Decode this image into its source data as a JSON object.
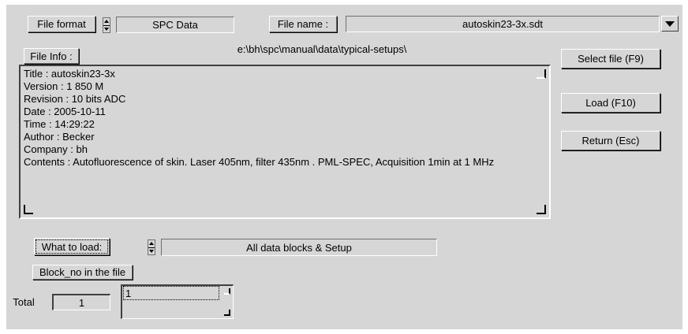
{
  "file_format": {
    "label": "File format",
    "value": "SPC Data"
  },
  "file_name": {
    "label": "File name :",
    "value": "autoskin23-3x.sdt"
  },
  "file_info": {
    "label": "File Info :",
    "path": "e:\\bh\\spc\\manual\\data\\typical-setups\\",
    "lines": [
      "Title : autoskin23-3x",
      "Version : 1 850 M",
      "Revision : 10 bits ADC",
      "Date : 2005-10-11",
      "Time : 14:29:22",
      "Author : Becker",
      "Company : bh",
      "Contents : Autofluorescence of skin. Laser 405nm, filter 435nm . PML-SPEC, Acquisition 1min at 1 MHz"
    ]
  },
  "buttons": {
    "select_file": "Select file (F9)",
    "load": "Load (F10)",
    "return": "Return (Esc)"
  },
  "what_to_load": {
    "label": "What to load:",
    "value": "All data blocks & Setup"
  },
  "block_no": {
    "label": "Block_no in the file",
    "value": "1"
  },
  "total": {
    "label": "Total",
    "value": "1"
  },
  "icons": {
    "spinner": "spinner-arrows-icon",
    "dropdown": "chevron-down-icon"
  }
}
